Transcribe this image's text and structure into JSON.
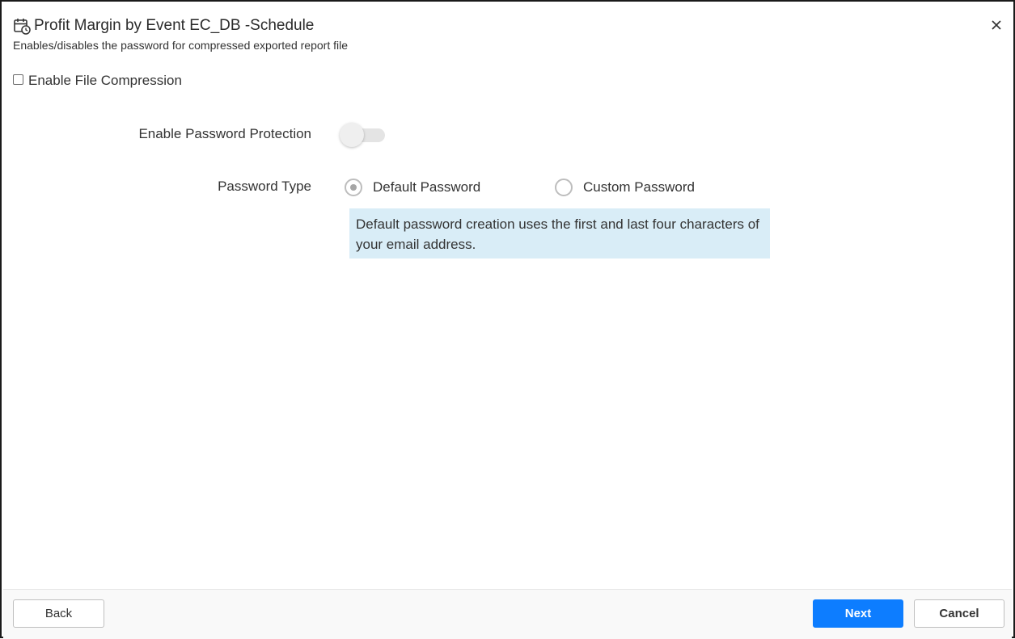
{
  "dialog": {
    "title": "Profit Margin by Event EC_DB -Schedule",
    "subtitle": "Enables/disables the password for compressed exported report file",
    "title_icon": "calendar-clock-icon",
    "close_icon": "close-icon"
  },
  "compression": {
    "label": "Enable File Compression",
    "checked": false
  },
  "password_protection": {
    "label": "Enable Password Protection",
    "enabled": false
  },
  "password_type": {
    "label": "Password Type",
    "options": [
      {
        "label": "Default Password",
        "selected": true
      },
      {
        "label": "Custom Password",
        "selected": false
      }
    ],
    "info": "Default password creation uses the first and last four characters of your email address."
  },
  "footer": {
    "back_label": "Back",
    "next_label": "Next",
    "cancel_label": "Cancel"
  },
  "colors": {
    "primary": "#0d7dff",
    "info_background": "#d9edf7",
    "border": "#1a1a1a"
  }
}
